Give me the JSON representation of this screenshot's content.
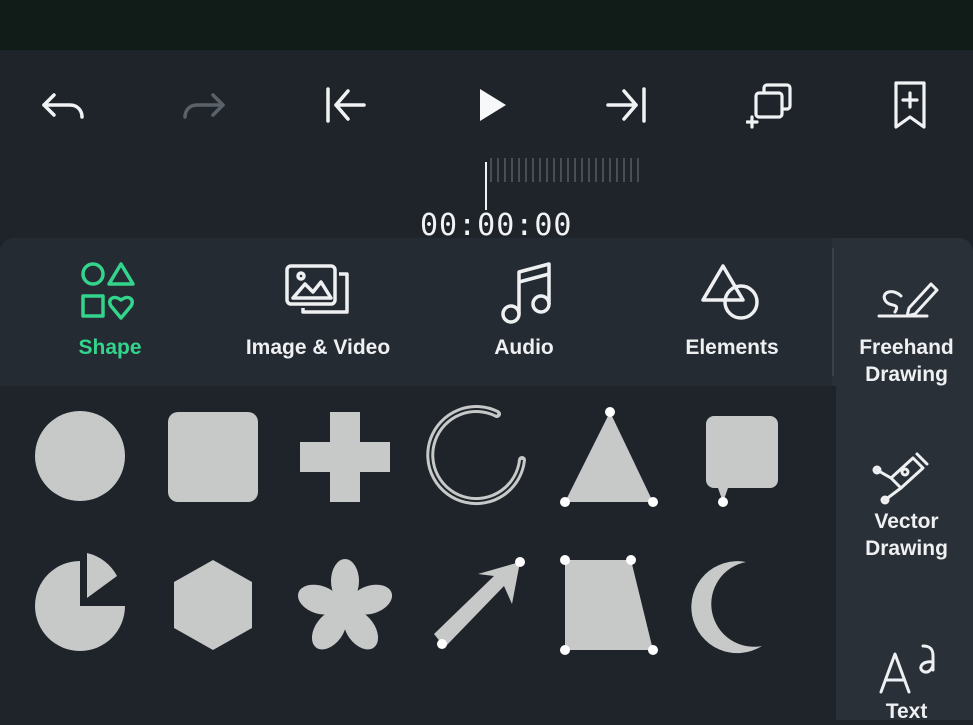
{
  "toolbar": {
    "icons": [
      "undo-icon",
      "redo-icon",
      "skip-to-start-icon",
      "play-icon",
      "skip-to-end-icon",
      "duplicate-layer-icon",
      "bookmark-add-icon"
    ]
  },
  "timeline": {
    "timecode": "00:00:00"
  },
  "tabs": [
    {
      "label": "Shape",
      "icon": "shapes-icon",
      "active": true
    },
    {
      "label": "Image & Video",
      "icon": "image-video-icon",
      "active": false
    },
    {
      "label": "Audio",
      "icon": "music-note-icon",
      "active": false
    },
    {
      "label": "Elements",
      "icon": "elements-icon",
      "active": false
    }
  ],
  "side_tools": [
    {
      "label_line1": "Freehand",
      "label_line2": "Drawing",
      "icon": "freehand-drawing-icon"
    },
    {
      "label_line1": "Vector",
      "label_line2": "Drawing",
      "icon": "vector-pen-icon"
    },
    {
      "label_line1": "Text",
      "label_line2": "",
      "icon": "text-icon"
    }
  ],
  "shapes": [
    "circle",
    "rounded-square",
    "cross",
    "ring-arc",
    "triangle",
    "speech-bubble",
    "pie",
    "hexagon",
    "flower",
    "arrow",
    "trapezoid",
    "crescent"
  ],
  "colors": {
    "accent": "#33d48b",
    "shape_fill": "#c7c9c8",
    "background": "#1f242b",
    "panel": "#2a3038"
  }
}
